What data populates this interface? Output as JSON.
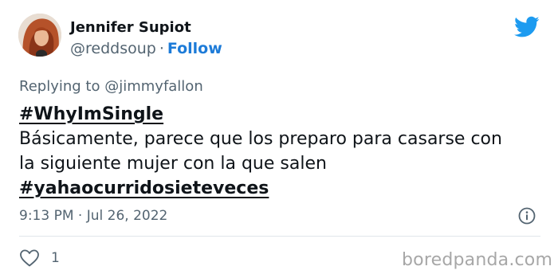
{
  "author": {
    "name": "Jennifer Supiot",
    "handle": "@reddsoup",
    "separator": "·",
    "follow_label": "Follow"
  },
  "reply_context": {
    "prefix": "Replying to",
    "mention": "@jimmyfallon"
  },
  "tweet": {
    "hashtag_top": "#WhyImSingle",
    "line1": "Básicamente, parece que los preparo para casarse con",
    "line2": "la siguiente mujer con la que salen",
    "hashtag_bottom": "#yahaocurridosieteveces"
  },
  "meta": {
    "timestamp": "9:13 PM · Jul 26, 2022"
  },
  "actions": {
    "like_count": "1"
  },
  "watermark": "boredpanda.com",
  "colors": {
    "link": "#1d7bd8",
    "twitter_blue": "#1d9bf0",
    "muted_text": "#536471",
    "text": "#0f1419",
    "watermark": "#a7a7a7"
  },
  "icons": {
    "brand": "twitter-bird-icon",
    "info": "info-icon",
    "like": "heart-icon"
  }
}
